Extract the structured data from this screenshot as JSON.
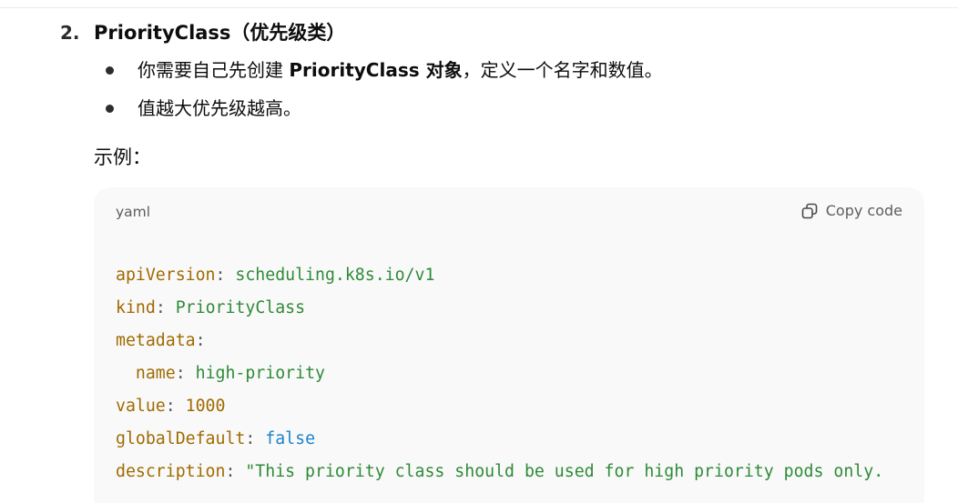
{
  "content": {
    "list_number": "2.",
    "heading": "PriorityClass（优先级类）",
    "bullets": [
      {
        "text_before": "你需要自己先创建 ",
        "text_bold": "PriorityClass 对象",
        "text_after": "，定义一个名字和数值。"
      },
      {
        "text": "值越大优先级越高。"
      }
    ],
    "example_label": "示例："
  },
  "code_block": {
    "language": "yaml",
    "copy_label": "Copy code",
    "copy_icon": "copy-icon",
    "lines": [
      {
        "key": "apiVersion",
        "sep": ":",
        "value": "scheduling.k8s.io/v1",
        "value_kind": "string"
      },
      {
        "key": "kind",
        "sep": ":",
        "value": "PriorityClass",
        "value_kind": "string"
      },
      {
        "key": "metadata",
        "sep": ":",
        "value": "",
        "value_kind": "none"
      },
      {
        "indent": "  ",
        "key": "name",
        "sep": ":",
        "value": "high-priority",
        "value_kind": "string"
      },
      {
        "key": "value",
        "sep": ":",
        "value": "1000",
        "value_kind": "number"
      },
      {
        "key": "globalDefault",
        "sep": ":",
        "value": "false",
        "value_kind": "boolean"
      },
      {
        "key": "description",
        "sep": ":",
        "value": "\"This priority class should be used for high priority pods only.",
        "value_kind": "string"
      }
    ]
  },
  "colors": {
    "key": "#a06a00",
    "string": "#2e8a37",
    "number": "#a06a00",
    "boolean": "#1a84c7",
    "code_background": "#f9f9f9"
  }
}
